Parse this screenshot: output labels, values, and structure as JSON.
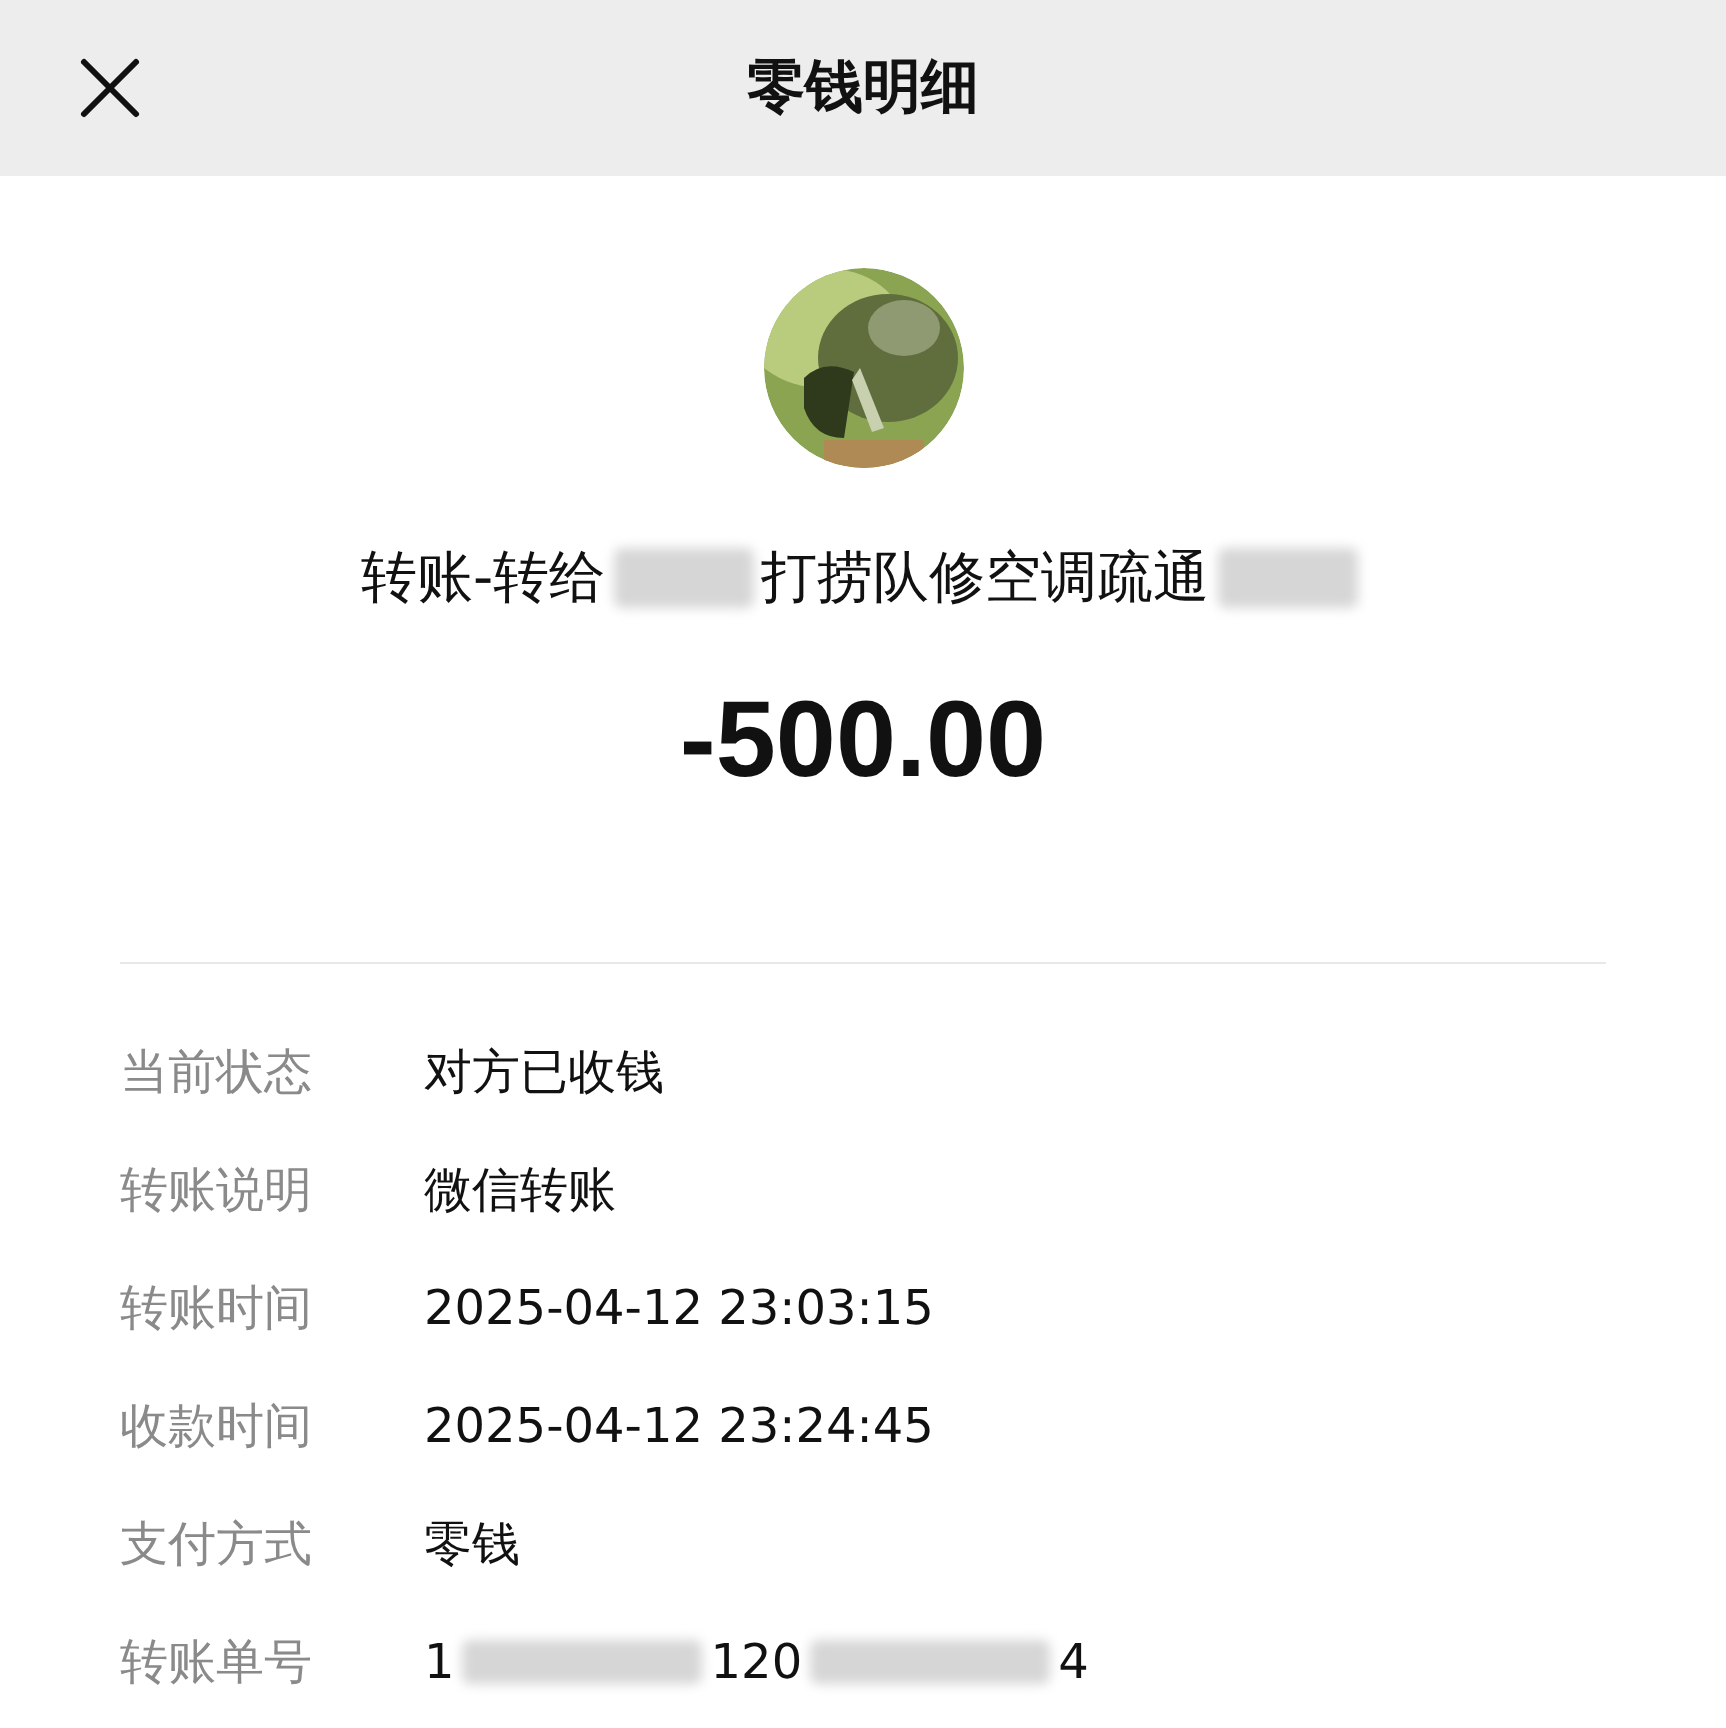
{
  "header": {
    "title": "零钱明细"
  },
  "transaction": {
    "title_parts": [
      {
        "kind": "text",
        "text": "转账-转给"
      },
      {
        "kind": "redacted"
      },
      {
        "kind": "text",
        "text": "打捞队修空调疏通"
      },
      {
        "kind": "redacted"
      }
    ],
    "amount": "-500.00"
  },
  "details": [
    {
      "label": "当前状态",
      "parts": [
        {
          "kind": "text",
          "text": "对方已收钱"
        }
      ]
    },
    {
      "label": "转账说明",
      "parts": [
        {
          "kind": "text",
          "text": "微信转账"
        }
      ]
    },
    {
      "label": "转账时间",
      "parts": [
        {
          "kind": "text",
          "text": "2025-04-12 23:03:15"
        }
      ]
    },
    {
      "label": "收款时间",
      "parts": [
        {
          "kind": "text",
          "text": "2025-04-12 23:24:45"
        }
      ]
    },
    {
      "label": "支付方式",
      "parts": [
        {
          "kind": "text",
          "text": "零钱"
        }
      ]
    },
    {
      "label": "转账单号",
      "parts": [
        {
          "kind": "text",
          "text": "1"
        },
        {
          "kind": "redacted"
        },
        {
          "kind": "text",
          "text": "120"
        },
        {
          "kind": "redacted"
        },
        {
          "kind": "text",
          "text": "4"
        }
      ]
    }
  ]
}
